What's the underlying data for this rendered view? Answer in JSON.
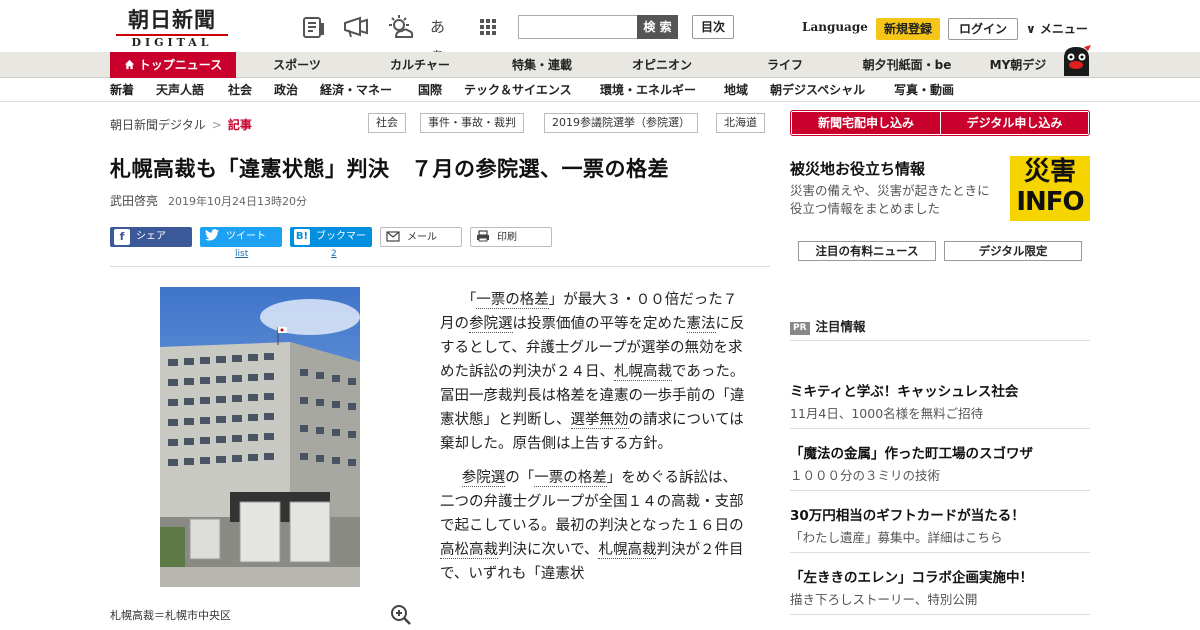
{
  "header": {
    "logo_jp": "朝日新聞",
    "logo_en": "DIGITAL",
    "icons": [
      "newspaper-icon",
      "megaphone-icon",
      "weather-icon",
      "font-size-icon",
      "grid-icon"
    ],
    "font_icon_text": "あぁ",
    "search_placeholder": "",
    "search_label": "検 索",
    "mokuji_label": "目次",
    "language_label": "Language",
    "register_label": "新規登録",
    "login_label": "ログイン",
    "menu_label": "∨ メニュー"
  },
  "mainnav": [
    "トップニュース",
    "スポーツ",
    "カルチャー",
    "特集・連載",
    "オピニオン",
    "ライフ",
    "朝夕刊紙面・be",
    "MY朝デジ"
  ],
  "subnav": [
    "新着",
    "天声人語",
    "社会",
    "政治",
    "経済・マネー",
    "国際",
    "テック＆サイエンス",
    "環境・エネルギー",
    "地域",
    "朝デジスペシャル",
    "写真・動画"
  ],
  "breadcrumb": {
    "root": "朝日新聞デジタル",
    "sep": ">",
    "current": "記事"
  },
  "tags": [
    "社会",
    "事件・事故・裁判",
    "2019参議院選挙（参院選）",
    "北海道"
  ],
  "article": {
    "title": "札幌高裁も「違憲状態」判決　７月の参院選、一票の格差",
    "author": "武田啓亮",
    "date": "2019年10月24日13時20分",
    "share": {
      "facebook": "シェア",
      "twitter": "ツイート",
      "hatena": "ブックマーク",
      "hatena_icon": "B!",
      "mail": "メール",
      "print": "印刷",
      "twitter_count": "list",
      "hatena_count": "2"
    },
    "photo_caption": "札幌高裁＝札幌市中央区",
    "p1": {
      "a": "「",
      "kw1": "一票の格差",
      "b": "」が最大３・００倍だった７月の",
      "kw2": "参院選",
      "c": "は投票価値の平等を定めた",
      "kw3": "憲法",
      "d": "に反するとして、弁護士グループが選挙の無効を求めた訴訟の判決が２４日、",
      "kw4": "札幌高裁",
      "e": "であった。冨田一彦裁判長は格差を違憲の一歩手前の「違憲状態」と判断し、",
      "kw5": "選挙無効",
      "f": "の請求については棄却した。原告側は上告する方針。"
    },
    "p2": {
      "kw1": "参院選",
      "a": "の「",
      "kw2": "一票の格差",
      "b": "」をめぐる訴訟は、二つの弁護士グループが全国１４の高裁・支部で起こしている。最初の判決となった１６日の",
      "kw3": "高松高裁",
      "c": "判決に次いで、",
      "kw4": "札幌高裁",
      "d": "判決が２件目で、いずれも「違憲状"
    }
  },
  "sidebar": {
    "btn_home_delivery": "新聞宅配申し込み",
    "btn_digital": "デジタル申し込み",
    "disaster_heading": "被災地お役立ち情報",
    "disaster_desc": "災害の備えや、災害が起きたときに役立つ情報をまとめました",
    "saigai_top": "災害",
    "saigai_bottom": "INFO",
    "tab_paid": "注目の有料ニュース",
    "tab_digital": "デジタル限定",
    "pr_badge": "PR",
    "pr_label": "注目情報",
    "items": [
      {
        "title": "ミキティと学ぶ！キャッシュレス社会",
        "sub": "11月4日、1000名様を無料ご招待"
      },
      {
        "title": "「魔法の金属」作った町工場のスゴワザ",
        "sub": "１０００分の３ミリの技術"
      },
      {
        "title": "30万円相当のギフトカードが当たる！",
        "sub": "「わたし遺産」募集中。詳細はこちら"
      },
      {
        "title": "「左ききのエレン」コラボ企画実施中！",
        "sub": "描き下ろしストーリー、特別公開"
      }
    ]
  },
  "colors": {
    "brand_red": "#c9002b",
    "register_yellow": "#f5c518",
    "saigai_yellow": "#f5d400"
  }
}
